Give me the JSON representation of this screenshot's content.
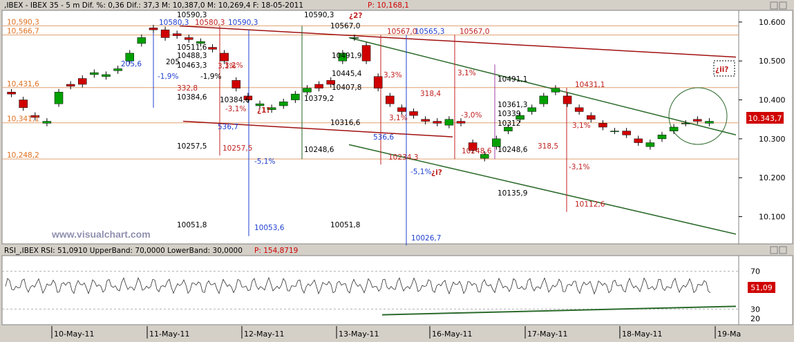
{
  "main_header": {
    "label_left": ",IBEX - IBEX 35 - 5 m Dif. %: 0,36 Dif.: 37,3 M: 10,387,0 M: 10,269,4 F: 18-05-2011",
    "label_p": "P: 10,168,1"
  },
  "rsi_header": {
    "label_left": "RSI_,IBEX RSI: 51,0910 UpperBand: 70,0000 LowerBand: 30,0000",
    "label_p": "P: 154,8719"
  },
  "watermark": "www.visualchart.com",
  "last_price": "10.343,7",
  "last_rsi": "51,09",
  "colors": {
    "bg": "#ffffff",
    "up": "#00a000",
    "down": "#d00000",
    "resistance": "#e07020",
    "support": "#206020",
    "fib": "#0000c0",
    "annot_red": "#d00000",
    "annot_blue": "#2040d0"
  },
  "chart_data": [
    {
      "type": "candlestick",
      "title": ",IBEX - IBEX 35 - 5 m",
      "x_ticks": [
        "10-May-11",
        "11-May-11",
        "12-May-11",
        "13-May-11",
        "16-May-11",
        "17-May-11",
        "18-May-11",
        "19-Ma"
      ],
      "y_ticks": [
        "10.600",
        "10.500",
        "10.400",
        "10.300",
        "10.200",
        "10.100"
      ],
      "ylim": [
        10030,
        10630
      ],
      "price_path": [
        [
          10420,
          10415
        ],
        [
          10400,
          10380
        ],
        [
          10360,
          10355
        ],
        [
          10340,
          10345
        ],
        [
          10390,
          10420
        ],
        [
          10440,
          10435
        ],
        [
          10455,
          10440
        ],
        [
          10465,
          10470
        ],
        [
          10460,
          10465
        ],
        [
          10475,
          10480
        ],
        [
          10500,
          10520
        ],
        [
          10545,
          10560
        ],
        [
          10585,
          10580
        ],
        [
          10580,
          10560
        ],
        [
          10570,
          10565
        ],
        [
          10560,
          10555
        ],
        [
          10545,
          10550
        ],
        [
          10535,
          10530
        ],
        [
          10520,
          10500
        ],
        [
          10450,
          10430
        ],
        [
          10410,
          10400
        ],
        [
          10385,
          10390
        ],
        [
          10375,
          10380
        ],
        [
          10385,
          10395
        ],
        [
          10400,
          10415
        ],
        [
          10420,
          10430
        ],
        [
          10440,
          10430
        ],
        [
          10450,
          10440
        ],
        [
          10500,
          10520
        ],
        [
          10560,
          10560
        ],
        [
          10540,
          10500
        ],
        [
          10460,
          10430
        ],
        [
          10410,
          10390
        ],
        [
          10380,
          10370
        ],
        [
          10370,
          10360
        ],
        [
          10350,
          10345
        ],
        [
          10345,
          10340
        ],
        [
          10335,
          10350
        ],
        [
          10345,
          10340
        ],
        [
          10290,
          10270
        ],
        [
          10250,
          10260
        ],
        [
          10280,
          10300
        ],
        [
          10320,
          10330
        ],
        [
          10350,
          10360
        ],
        [
          10370,
          10380
        ],
        [
          10390,
          10410
        ],
        [
          10420,
          10430
        ],
        [
          10410,
          10390
        ],
        [
          10380,
          10370
        ],
        [
          10360,
          10350
        ],
        [
          10340,
          10330
        ],
        [
          10320,
          10320
        ],
        [
          10320,
          10310
        ],
        [
          10300,
          10290
        ],
        [
          10280,
          10290
        ],
        [
          10300,
          10310
        ],
        [
          10320,
          10330
        ],
        [
          10340,
          10340
        ],
        [
          10350,
          10345
        ],
        [
          10340,
          10345
        ]
      ],
      "levels": [
        {
          "label": "10,590,3",
          "value": 10590.3
        },
        {
          "label": "10,566,7",
          "value": 10566.7
        },
        {
          "label": "10,431,6",
          "value": 10431.6
        },
        {
          "label": "10,341,1",
          "value": 10341.1
        },
        {
          "label": "10,248,2",
          "value": 10248.2
        }
      ],
      "annotations": [
        {
          "text": "10590,3",
          "value": 10590.3
        },
        {
          "text": "10580,3",
          "value": 10580.3
        },
        {
          "text": "10580,3",
          "value": 10580.3
        },
        {
          "text": "10590,3",
          "value": 10590.3
        },
        {
          "text": "10590,3",
          "value": 10590.3
        },
        {
          "text": "¿2?",
          "value": 10590
        },
        {
          "text": "10567,0",
          "value": 10567
        },
        {
          "text": "10567,0",
          "value": 10567
        },
        {
          "text": "10567,0",
          "value": 10567
        },
        {
          "text": "10565,3",
          "value": 10565.3
        },
        {
          "text": "10511,6",
          "value": 10511.6
        },
        {
          "text": "10488,3",
          "value": 10488.3
        },
        {
          "text": "10463,3",
          "value": 10463.3
        },
        {
          "text": "10491,9",
          "value": 10491.9
        },
        {
          "text": "10445,4",
          "value": 10445.4
        },
        {
          "text": "10407,8",
          "value": 10407.8
        },
        {
          "text": "10379,2",
          "value": 10379.2
        },
        {
          "text": "10384,6",
          "value": 10384.6
        },
        {
          "text": "10384,6",
          "value": 10384.6
        },
        {
          "text": "10491,1",
          "value": 10491.1
        },
        {
          "text": "10431,1",
          "value": 10431.1
        },
        {
          "text": "10361,3",
          "value": 10361.3
        },
        {
          "text": "10339",
          "value": 10339
        },
        {
          "text": "10316,6",
          "value": 10316.6
        },
        {
          "text": "10312",
          "value": 10312
        },
        {
          "text": "10257,5",
          "value": 10257.5
        },
        {
          "text": "10257,5",
          "value": 10257.5
        },
        {
          "text": "10248,6",
          "value": 10248.6
        },
        {
          "text": "10248,6",
          "value": 10248.6
        },
        {
          "text": "10248,6",
          "value": 10248.6
        },
        {
          "text": "10234,3",
          "value": 10234.3
        },
        {
          "text": "10135,9",
          "value": 10135.9
        },
        {
          "text": "10112,6",
          "value": 10112.6
        },
        {
          "text": "10051,8",
          "value": 10051.8
        },
        {
          "text": "10053,6",
          "value": 10053.6
        },
        {
          "text": "10051,8",
          "value": 10051.8
        },
        {
          "text": "10026,7",
          "value": 10026.7
        },
        {
          "text": "3,1%"
        },
        {
          "text": "3,2%"
        },
        {
          "text": "3,3%"
        },
        {
          "text": "-1,9%"
        },
        {
          "text": "-1,9%"
        },
        {
          "text": "-3,1%"
        },
        {
          "text": "-3,0%"
        },
        {
          "text": "-3,1%"
        },
        {
          "text": "3,1%"
        },
        {
          "text": "-5,1%"
        },
        {
          "text": "-5,1%"
        },
        {
          "text": "3,1%"
        },
        {
          "text": "3,1%"
        },
        {
          "text": "332,8"
        },
        {
          "text": "318,4"
        },
        {
          "text": "318,5"
        },
        {
          "text": "536,7"
        },
        {
          "text": "536,6"
        },
        {
          "text": "205,6"
        },
        {
          "text": "205"
        },
        {
          "text": "¿1?"
        },
        {
          "text": "¿i?"
        },
        {
          "text": "¿ii?"
        }
      ]
    },
    {
      "type": "line",
      "title": "RSI_,IBEX RSI",
      "y_ticks": [
        "70",
        "50",
        "30",
        "20"
      ],
      "ylim": [
        15,
        85
      ],
      "bands": [
        70,
        30
      ],
      "last_value": 51.09
    }
  ]
}
